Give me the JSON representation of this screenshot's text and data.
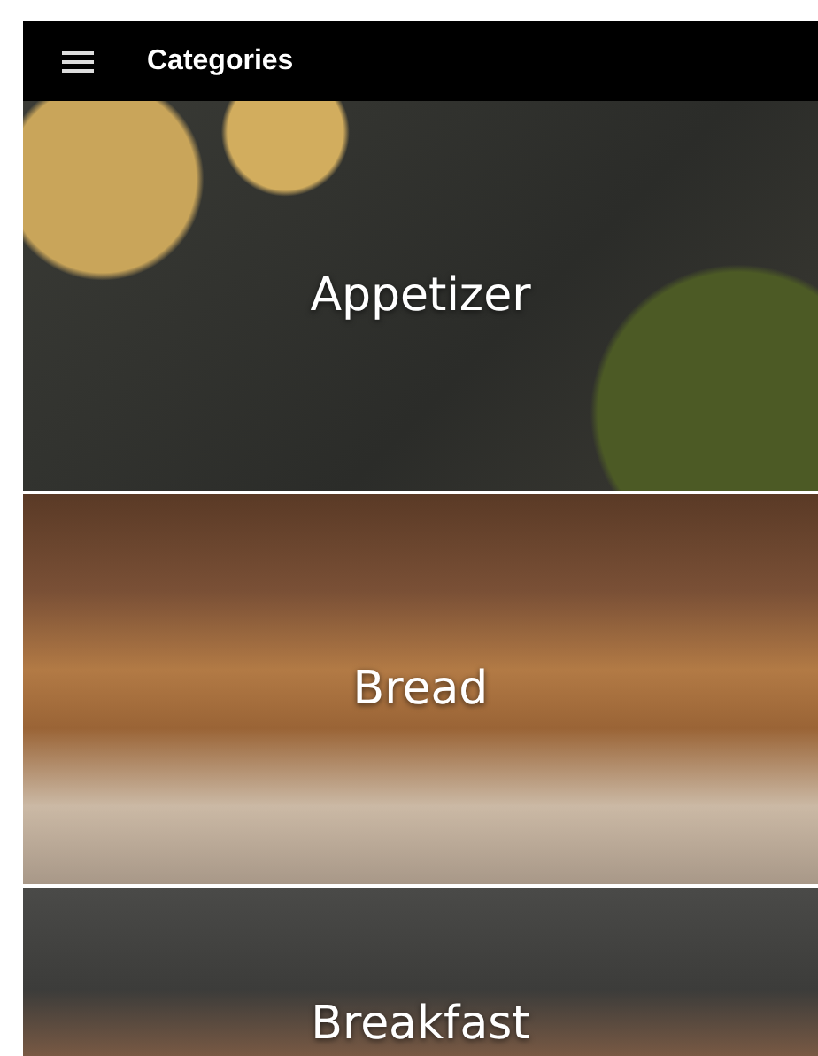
{
  "app_bar": {
    "title": "Categories"
  },
  "categories": [
    {
      "name": "Appetizer"
    },
    {
      "name": "Bread"
    },
    {
      "name": "Breakfast"
    }
  ]
}
